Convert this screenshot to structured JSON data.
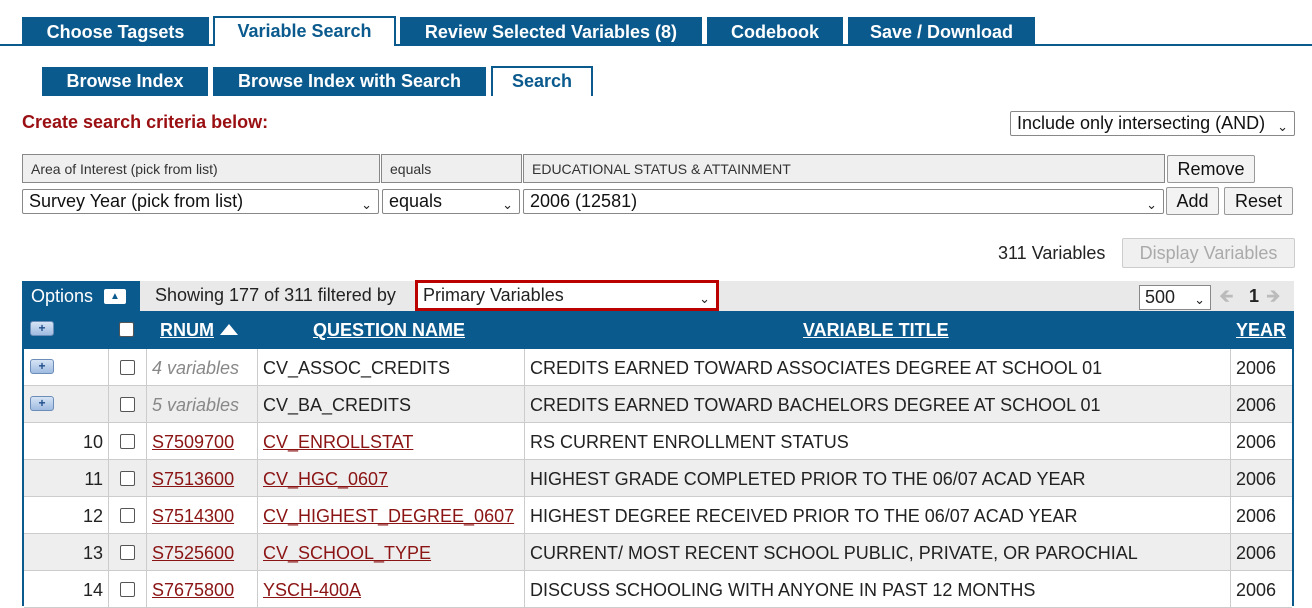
{
  "top_tabs": [
    {
      "label": "Choose Tagsets"
    },
    {
      "label": "Variable Search"
    },
    {
      "label": "Review Selected Variables (8)"
    },
    {
      "label": "Codebook"
    },
    {
      "label": "Save / Download"
    }
  ],
  "sub_tabs": [
    {
      "label": "Browse Index"
    },
    {
      "label": "Browse Index with Search"
    },
    {
      "label": "Search"
    }
  ],
  "criteria": {
    "heading": "Create search criteria below:",
    "combine_mode": "Include only intersecting (AND)",
    "row1": {
      "field": "Area of Interest   (pick from list)",
      "op": "equals",
      "value": "EDUCATIONAL STATUS & ATTAINMENT",
      "button": "Remove"
    },
    "row2": {
      "field": "Survey Year   (pick from list)",
      "op": "equals",
      "value": "2006 (12581)",
      "add": "Add",
      "reset": "Reset"
    }
  },
  "results": {
    "count_label": "311 Variables",
    "display_button": "Display Variables",
    "options_label": "Options",
    "showing_text": "Showing 177 of 311  filtered by",
    "filter_value": "Primary Variables",
    "page_size": "500",
    "page": "1"
  },
  "columns": {
    "rnum": "RNUM",
    "qname": "QUESTION NAME",
    "title": "VARIABLE TITLE",
    "year": "YEAR"
  },
  "rows": [
    {
      "num": "",
      "rnum": "4 variables",
      "qname": "CV_ASSOC_CREDITS",
      "title": "CREDITS EARNED TOWARD ASSOCIATES DEGREE AT SCHOOL 01",
      "year": "2006",
      "group": true
    },
    {
      "num": "",
      "rnum": "5 variables",
      "qname": "CV_BA_CREDITS",
      "title": "CREDITS EARNED TOWARD BACHELORS DEGREE AT SCHOOL 01",
      "year": "2006",
      "group": true
    },
    {
      "num": "10",
      "rnum": "S7509700",
      "qname": "CV_ENROLLSTAT",
      "title": "RS CURRENT ENROLLMENT STATUS",
      "year": "2006",
      "group": false
    },
    {
      "num": "11",
      "rnum": "S7513600",
      "qname": "CV_HGC_0607",
      "title": "HIGHEST GRADE COMPLETED PRIOR TO THE 06/07 ACAD YEAR",
      "year": "2006",
      "group": false
    },
    {
      "num": "12",
      "rnum": "S7514300",
      "qname": "CV_HIGHEST_DEGREE_0607",
      "title": "HIGHEST DEGREE RECEIVED PRIOR TO THE 06/07 ACAD YEAR",
      "year": "2006",
      "group": false
    },
    {
      "num": "13",
      "rnum": "S7525600",
      "qname": "CV_SCHOOL_TYPE",
      "title": "CURRENT/ MOST RECENT SCHOOL PUBLIC, PRIVATE, OR PAROCHIAL",
      "year": "2006",
      "group": false
    },
    {
      "num": "14",
      "rnum": "S7675800",
      "qname": "YSCH-400A",
      "title": "DISCUSS SCHOOLING WITH ANYONE IN PAST 12 MONTHS",
      "year": "2006",
      "group": false
    }
  ]
}
